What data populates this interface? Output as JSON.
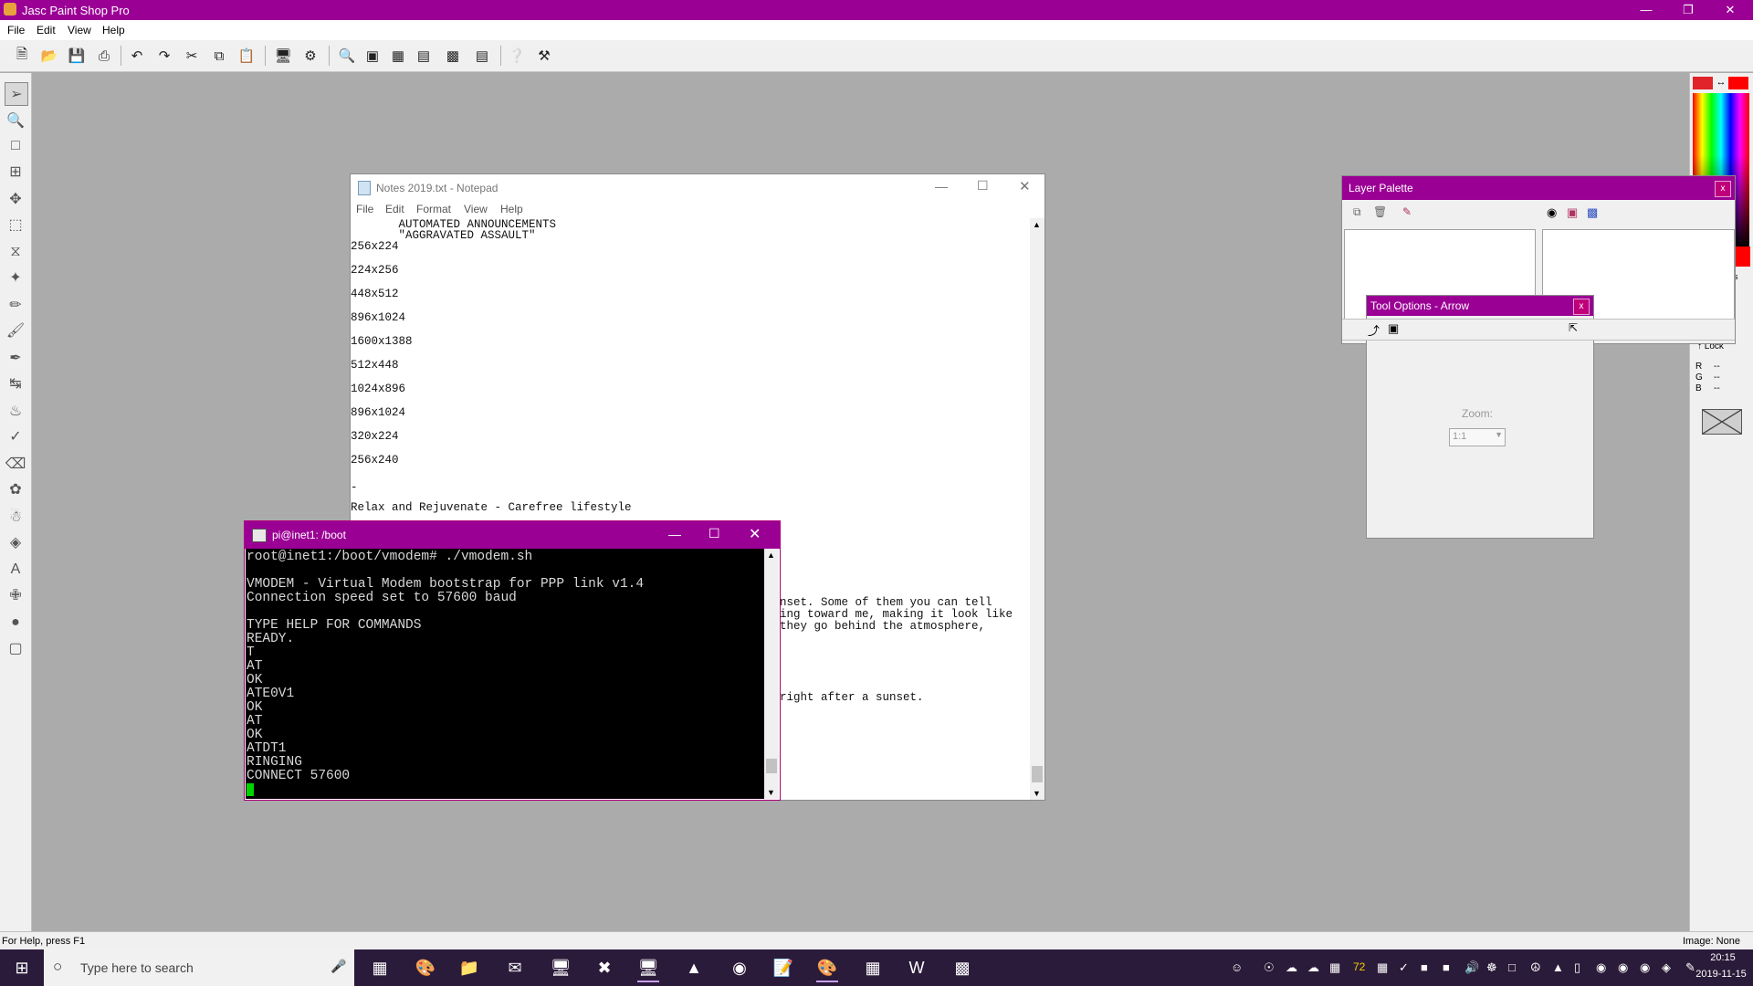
{
  "app": {
    "title": "Jasc Paint Shop Pro",
    "menu": [
      "File",
      "Edit",
      "View",
      "Help"
    ],
    "status_left": "For Help, press F1",
    "status_right": "Image: None"
  },
  "notepad": {
    "title": "Notes 2019.txt - Notepad",
    "menu": [
      "File",
      "Edit",
      "Format",
      "View",
      "Help"
    ],
    "lines": [
      "       AUTOMATED ANNOUNCEMENTS",
      "       \"AGGRAVATED ASSAULT\"",
      "256x224",
      "224x256",
      "448x512",
      "896x1024",
      "1600x1388",
      "512x448",
      "1024x896",
      "896x1024",
      "320x224",
      "256x240",
      "-",
      "Relax and Rejuvenate - Carefree lifestyle"
    ],
    "partial_lines": [
      "nset. Some of them you can tell",
      "ing toward me, making it look like",
      "they go behind the atmosphere,",
      "right after a sunset."
    ]
  },
  "terminal": {
    "title": "pi@inet1: /boot",
    "lines": [
      "root@inet1:/boot/vmodem# ./vmodem.sh",
      "",
      "VMODEM - Virtual Modem bootstrap for PPP link v1.4",
      "Connection speed set to 57600 baud",
      "",
      "TYPE HELP FOR COMMANDS",
      "READY.",
      "T",
      "AT",
      "OK",
      "ATE0V1",
      "OK",
      "AT",
      "OK",
      "ATDT1",
      "RINGING",
      "CONNECT 57600"
    ]
  },
  "layer_palette": {
    "title": "Layer Palette",
    "close": "x"
  },
  "tool_options": {
    "title": "Tool Options - Arrow",
    "close": "x",
    "zoom_label": "Zoom:",
    "zoom_value": "1:1"
  },
  "color_panel": {
    "lock_label": "Lock",
    "r_label": "R",
    "g_label": "G",
    "b_label": "B",
    "r_value": "--",
    "g_value": "--",
    "b_value": "--",
    "s_label": "s",
    "foreground": "#e0242a",
    "background": "#ff0000"
  },
  "taskbar": {
    "search_placeholder": "Type here to search",
    "time": "20:15",
    "date": "2019-11-15",
    "tray_number": "72"
  }
}
